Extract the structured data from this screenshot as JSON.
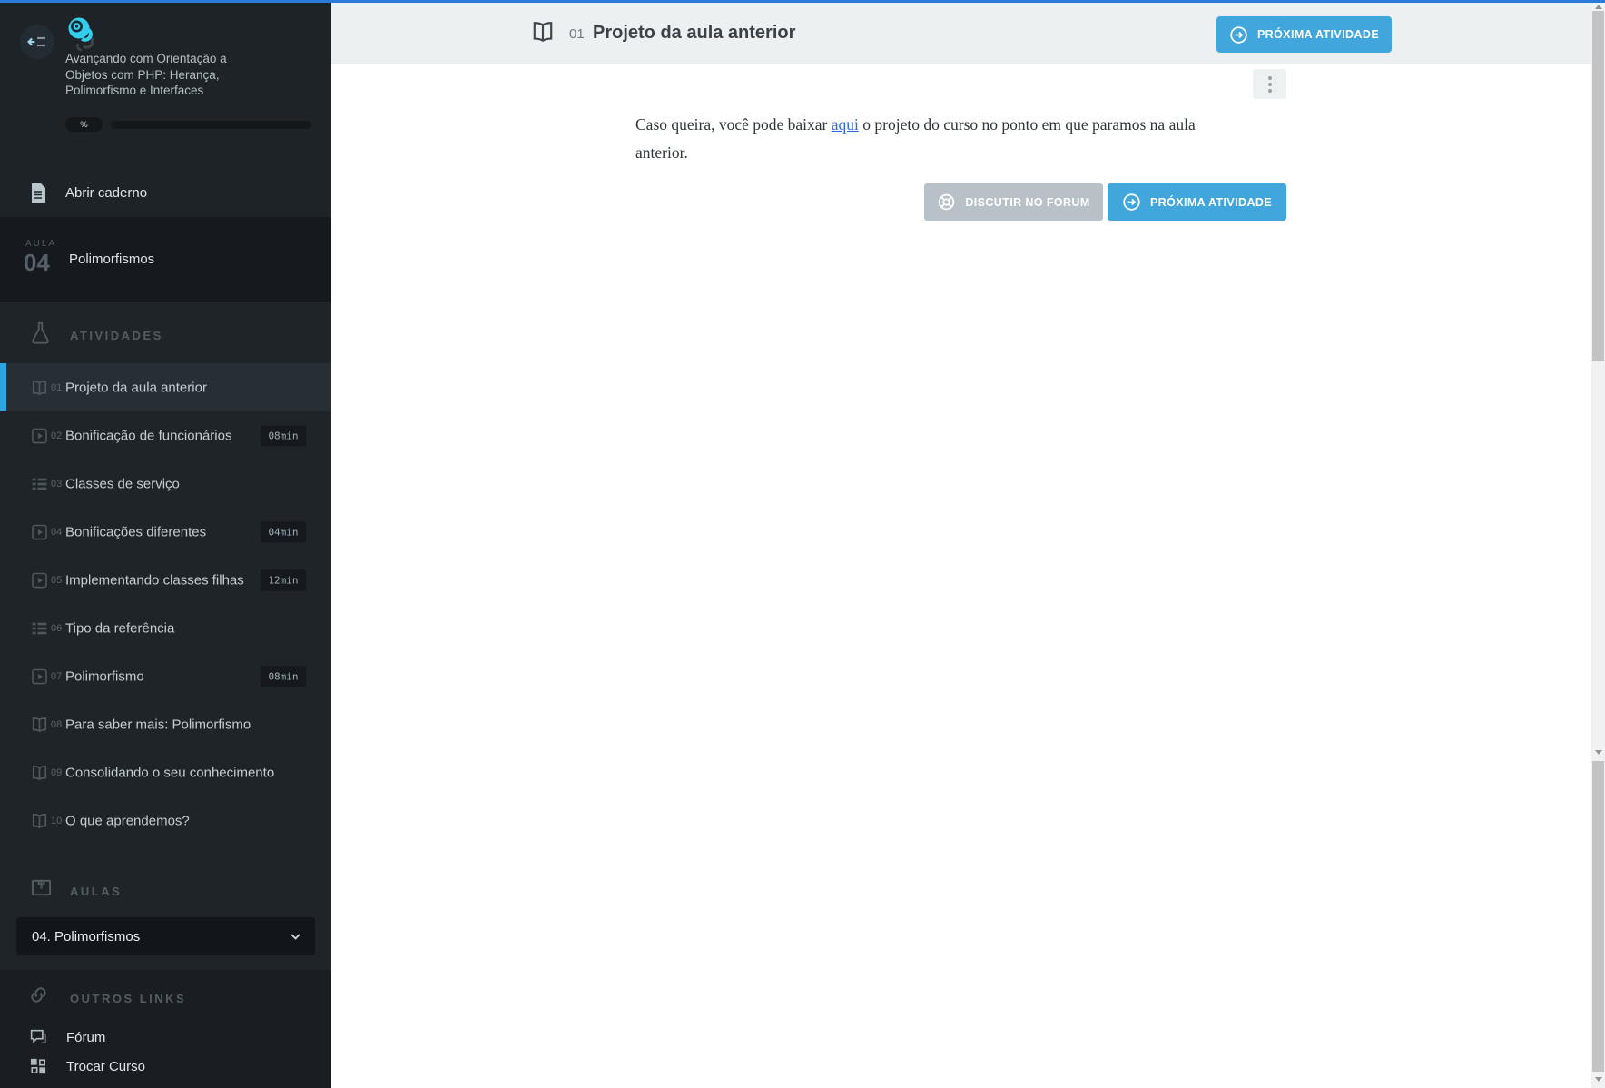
{
  "colors": {
    "top_bar_blue": "#2b7cd9",
    "accent_blue": "#41a6db",
    "active_item_blue": "#2ba6e0",
    "link_blue": "#2b6be0",
    "logo_cyan": "#35cdec",
    "sidebar_bg": "#1f2428",
    "header_band_bg": "#edf0f1"
  },
  "sidebar": {
    "course_title_lines": [
      "Avançando com Orientação a",
      "Objetos com PHP: Herança,",
      "Polimorfismo e Interfaces"
    ],
    "progress_label": "%",
    "notebook_label": "Abrir caderno",
    "lesson": {
      "label": "AULA",
      "number": "04",
      "title": "Polimorfismos"
    },
    "activities": {
      "header": "ATIVIDADES",
      "items": [
        {
          "num": "01",
          "label": "Projeto da aula anterior",
          "type": "book",
          "active": true,
          "duration": ""
        },
        {
          "num": "02",
          "label": "Bonificação de funcionários",
          "type": "video",
          "active": false,
          "duration": "08min"
        },
        {
          "num": "03",
          "label": "Classes de serviço",
          "type": "list",
          "active": false,
          "duration": ""
        },
        {
          "num": "04",
          "label": "Bonificações diferentes",
          "type": "video",
          "active": false,
          "duration": "04min"
        },
        {
          "num": "05",
          "label": "Implementando classes filhas",
          "type": "video",
          "active": false,
          "duration": "12min"
        },
        {
          "num": "06",
          "label": "Tipo da referência",
          "type": "list",
          "active": false,
          "duration": ""
        },
        {
          "num": "07",
          "label": "Polimorfismo",
          "type": "video",
          "active": false,
          "duration": "08min"
        },
        {
          "num": "08",
          "label": "Para saber mais: Polimorfismo",
          "type": "book",
          "active": false,
          "duration": ""
        },
        {
          "num": "09",
          "label": "Consolidando o seu conhecimento",
          "type": "book",
          "active": false,
          "duration": ""
        },
        {
          "num": "10",
          "label": "O que aprendemos?",
          "type": "book",
          "active": false,
          "duration": ""
        }
      ]
    },
    "aulas": {
      "header": "AULAS",
      "selected": "04. Polimorfismos"
    },
    "other_links": {
      "header": "OUTROS LINKS",
      "items": [
        "Fórum",
        "Trocar Curso"
      ]
    }
  },
  "main": {
    "activity_number": "01",
    "activity_title": "Projeto da aula anterior",
    "next_activity_button": "PRÓXIMA ATIVIDADE",
    "paragraph": {
      "before_link": "Caso queira, você pode baixar ",
      "link_text": "aqui",
      "after_link": " o projeto do curso no ponto em que paramos na aula anterior."
    },
    "forum_button": "DISCUTIR NO FORUM",
    "bottom_next_button": "PRÓXIMA ATIVIDADE"
  }
}
